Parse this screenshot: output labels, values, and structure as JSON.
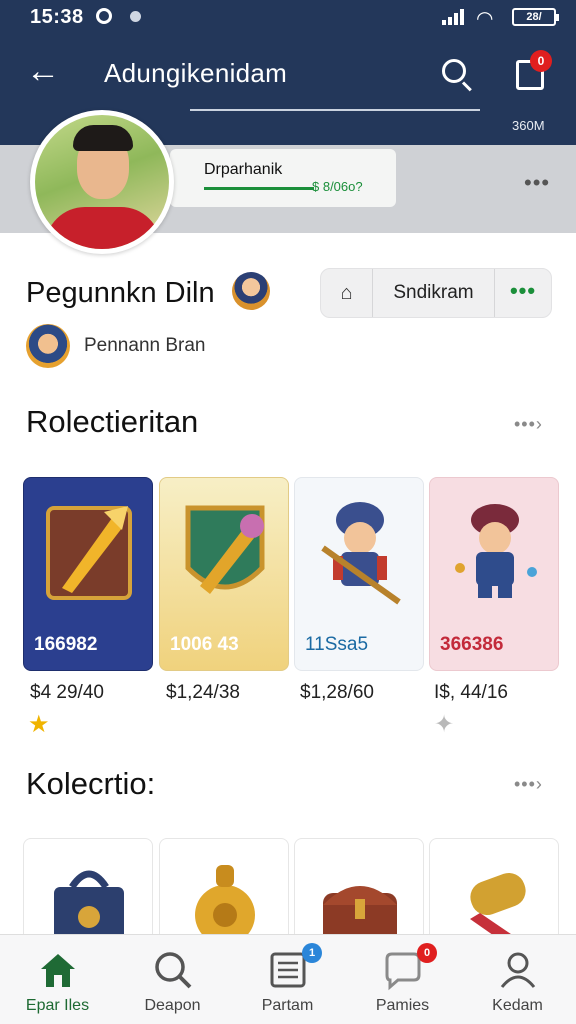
{
  "status_bar": {
    "time": "15:38",
    "battery": "28/"
  },
  "header": {
    "title": "Adungikenidam",
    "count": "360M",
    "cart_badge": "0"
  },
  "cover": {
    "name": "Drparhanik",
    "value": "$ 8/06o?"
  },
  "profile": {
    "name": "Pegunnkn Diln",
    "share_icon": "share-icon",
    "follow_label": "Sndikram",
    "more_label": "•••",
    "sub_name": "Pennann Bran"
  },
  "section_1": {
    "title": "Rolectieritan",
    "more": "•••›",
    "items": [
      {
        "value": "166982",
        "price": "$4 29/40",
        "color": "#2b3f8f",
        "star": "★",
        "star_color": "#f0b400"
      },
      {
        "value": "1006 43",
        "price": "$1,24/38",
        "color": "#f3e0a1",
        "star": "",
        "star_color": ""
      },
      {
        "value": "11Ssa5",
        "price": "$1,28/60",
        "color": "#f1f4f7",
        "star": "",
        "star_color": ""
      },
      {
        "value": "366386",
        "price": "I$, 44/16",
        "color": "#f6dbe0",
        "star": "✦",
        "star_color": "#b9b9b9"
      }
    ]
  },
  "section_2": {
    "title": "Kolecrtio:",
    "more": "•••›"
  },
  "bottom_nav": [
    {
      "label": "Epar Iles",
      "icon": "home-icon",
      "badge": ""
    },
    {
      "label": "Deapon",
      "icon": "search-icon",
      "badge": ""
    },
    {
      "label": "Partam",
      "icon": "list-icon",
      "badge": "1"
    },
    {
      "label": "Pamies",
      "icon": "chat-icon",
      "badge": "0"
    },
    {
      "label": "Kedam",
      "icon": "profile-icon",
      "badge": ""
    }
  ],
  "colors": {
    "header_bg": "#23375a",
    "accent_green": "#1b8f3a",
    "badge_red": "#e01f1f",
    "badge_blue": "#2b86d9"
  }
}
